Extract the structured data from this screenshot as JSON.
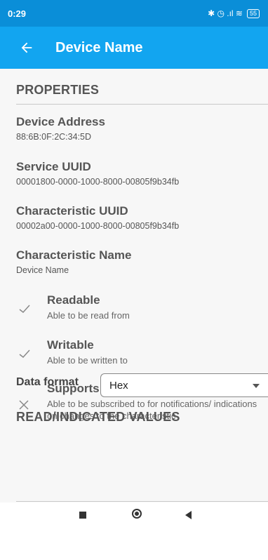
{
  "status_bar": {
    "time": "0:29",
    "icons": "✱ ◷ .ıl ≋",
    "battery": "55"
  },
  "app_bar": {
    "title": "Device Name"
  },
  "properties": {
    "header": "PROPERTIES",
    "fields": [
      {
        "label": "Device Address",
        "value": "88:6B:0F:2C:34:5D"
      },
      {
        "label": "Service UUID",
        "value": "00001800-0000-1000-8000-00805f9b34fb"
      },
      {
        "label": "Characteristic UUID",
        "value": "00002a00-0000-1000-8000-00805f9b34fb"
      },
      {
        "label": "Characteristic Name",
        "value": "Device Name"
      }
    ],
    "capabilities": [
      {
        "title": "Readable",
        "desc": "Able to be read from",
        "supported": true
      },
      {
        "title": "Writable",
        "desc": "Able to be written to",
        "supported": true
      },
      {
        "title": "Supports notifications/indications",
        "desc": "Able to be subscribed to for notifications/ indications on changes to the characteristic",
        "supported": false
      }
    ]
  },
  "data_format": {
    "label": "Data format",
    "selected": "Hex"
  },
  "values_section": {
    "header": "READ/INDICATED VALUES"
  },
  "colors": {
    "status_bar": "#0a8ed8",
    "app_bar": "#12a5f0",
    "content_bg": "#f7f7f7"
  }
}
